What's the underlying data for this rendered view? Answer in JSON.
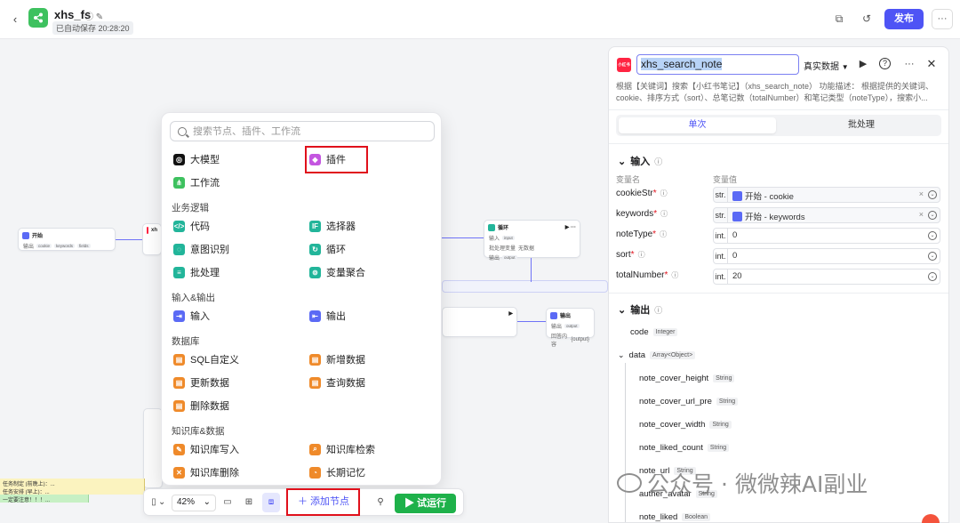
{
  "header": {
    "app_name": "xhs_fs",
    "autosave": "已自动保存 20:28:20",
    "publish_label": "发布",
    "more_label": "···",
    "back_label": "‹",
    "accent": "#4e54f5"
  },
  "canvas": {
    "node_start": {
      "title": "开始",
      "row1": "输出",
      "p1": "cookie",
      "p2": "keywords",
      "p3": "fields"
    },
    "node_plugin": {
      "title": "xh"
    },
    "node_loop": {
      "title": "循环",
      "row1": "输入",
      "c1": "input",
      "row2": "批处理变量",
      "c2": "无数据",
      "row3": "输出",
      "c3": "output"
    },
    "node_end_partial": {
      "title": "输出",
      "row1": "输出",
      "c1": "output",
      "row2": "回答内容",
      "c2": "{output}"
    },
    "stickies": [
      "任务制定 (前晚上)：...",
      "任务安排 (早上)：...",
      "一定要注意！！！..."
    ]
  },
  "popup": {
    "search_placeholder": "搜索节点、插件、工作流",
    "items": {
      "llm": "大模型",
      "plugin": "插件",
      "workflow": "工作流",
      "code": "代码",
      "selector": "选择器",
      "intent": "意图识别",
      "loop": "循环",
      "batch": "批处理",
      "var_agg": "变量聚合",
      "input": "输入",
      "output": "输出",
      "sql": "SQL自定义",
      "insert": "新增数据",
      "update": "更新数据",
      "query": "查询数据",
      "delete": "删除数据",
      "kb_write": "知识库写入",
      "kb_search": "知识库检索",
      "kb_delete": "知识库删除",
      "memory": "长期记忆"
    },
    "sections": {
      "logic": "业务逻辑",
      "io": "输入&输出",
      "db": "数据库",
      "kb": "知识库&数据"
    }
  },
  "toolbar": {
    "zoom": "42%",
    "add_node": "添加节点",
    "run": "试运行"
  },
  "panel": {
    "logo_text": "小红书",
    "node_name": "xhs_search_note",
    "data_mode": "真实数据",
    "description": "根据【关键词】搜索【小红书笔记】（xhs_search_note） 功能描述： 根据提供的关键词、cookie、排序方式（sort）、总笔记数（totalNumber）和笔记类型（noteType），搜索小...",
    "tab_single": "单次",
    "tab_batch": "批处理",
    "input_title": "输入",
    "col_name": "变量名",
    "col_value": "变量值",
    "inputs": [
      {
        "name": "cookieStr",
        "type": "str.",
        "value": "开始 - cookie",
        "ref": true
      },
      {
        "name": "keywords",
        "type": "str.",
        "value": "开始 - keywords",
        "ref": true
      },
      {
        "name": "noteType",
        "type": "int.",
        "value": "0",
        "ref": false
      },
      {
        "name": "sort",
        "type": "int.",
        "value": "0",
        "ref": false
      },
      {
        "name": "totalNumber",
        "type": "int.",
        "value": "20",
        "ref": false
      }
    ],
    "output_title": "输出",
    "outputs": [
      {
        "name": "code",
        "type": "Integer"
      },
      {
        "name": "data",
        "type": "Array<Object>"
      },
      {
        "name": "note_cover_height",
        "type": "String"
      },
      {
        "name": "note_cover_url_pre",
        "type": "String"
      },
      {
        "name": "note_cover_width",
        "type": "String"
      },
      {
        "name": "note_liked_count",
        "type": "String"
      },
      {
        "name": "note_url",
        "type": "String"
      },
      {
        "name": "auther_avatar",
        "type": "String"
      },
      {
        "name": "note_liked",
        "type": "Boolean"
      }
    ]
  },
  "watermark": "公众号 · 微微辣AI副业"
}
